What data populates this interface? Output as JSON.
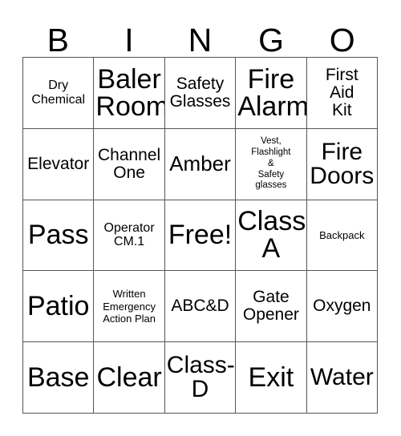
{
  "card": {
    "type": "bingo-card",
    "columns": 5,
    "rows": 5,
    "header_letters": [
      "B",
      "I",
      "N",
      "G",
      "O"
    ],
    "border_color": "#555555",
    "text_color": "#000000",
    "background_color": "#ffffff",
    "cells": [
      {
        "text": "Dry\nChemical",
        "size": "sm",
        "column": "B",
        "row": 1
      },
      {
        "text": "Baler\nRoom",
        "size": "xxl",
        "column": "I",
        "row": 1
      },
      {
        "text": "Safety\nGlasses",
        "size": "md",
        "column": "N",
        "row": 1
      },
      {
        "text": "Fire\nAlarm",
        "size": "xxl",
        "column": "G",
        "row": 1
      },
      {
        "text": "First\nAid\nKit",
        "size": "md",
        "column": "O",
        "row": 1
      },
      {
        "text": "Elevator",
        "size": "md",
        "column": "B",
        "row": 2
      },
      {
        "text": "Channel\nOne",
        "size": "md",
        "column": "I",
        "row": 2
      },
      {
        "text": "Amber",
        "size": "lg",
        "column": "N",
        "row": 2
      },
      {
        "text": "Vest,\nFlashlight\n&\nSafety\nglasses",
        "size": "xxs",
        "column": "G",
        "row": 2
      },
      {
        "text": "Fire\nDoors",
        "size": "xl",
        "column": "O",
        "row": 2
      },
      {
        "text": "Pass",
        "size": "xxl",
        "column": "B",
        "row": 3
      },
      {
        "text": "Operator\nCM.1",
        "size": "sm",
        "column": "I",
        "row": 3
      },
      {
        "text": "Free!",
        "size": "xxl",
        "column": "N",
        "row": 3
      },
      {
        "text": "Class-\nA",
        "size": "xxl",
        "column": "G",
        "row": 3
      },
      {
        "text": "Backpack",
        "size": "xs",
        "column": "O",
        "row": 3
      },
      {
        "text": "Patio",
        "size": "xxl",
        "column": "B",
        "row": 4
      },
      {
        "text": "Written\nEmergency\nAction Plan",
        "size": "xs",
        "column": "I",
        "row": 4
      },
      {
        "text": "ABC&D",
        "size": "md",
        "column": "N",
        "row": 4
      },
      {
        "text": "Gate\nOpener",
        "size": "md",
        "column": "G",
        "row": 4
      },
      {
        "text": "Oxygen",
        "size": "md",
        "column": "O",
        "row": 4
      },
      {
        "text": "Base",
        "size": "xxl",
        "column": "B",
        "row": 5
      },
      {
        "text": "Clear",
        "size": "xxl",
        "column": "I",
        "row": 5
      },
      {
        "text": "Class-\nD",
        "size": "xl",
        "column": "N",
        "row": 5
      },
      {
        "text": "Exit",
        "size": "xxl",
        "column": "G",
        "row": 5
      },
      {
        "text": "Water",
        "size": "xl",
        "column": "O",
        "row": 5
      }
    ]
  }
}
